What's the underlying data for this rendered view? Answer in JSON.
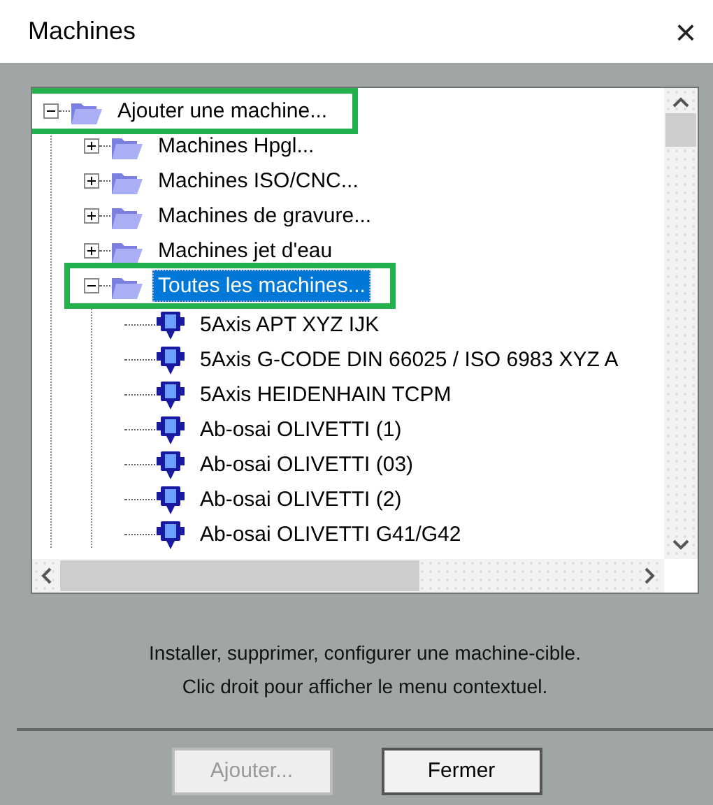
{
  "window": {
    "title": "Machines",
    "close": "×"
  },
  "tree": [
    {
      "label": "Ajouter une machine...",
      "kind": "folder",
      "expanded": true,
      "selected": false,
      "highlighted": true,
      "children": [
        {
          "label": "Machines Hpgl...",
          "kind": "folder",
          "expanded": false,
          "selected": false,
          "highlighted": false
        },
        {
          "label": "Machines ISO/CNC...",
          "kind": "folder",
          "expanded": false,
          "selected": false,
          "highlighted": false
        },
        {
          "label": "Machines de gravure...",
          "kind": "folder",
          "expanded": false,
          "selected": false,
          "highlighted": false
        },
        {
          "label": "Machines jet d'eau",
          "kind": "folder",
          "expanded": false,
          "selected": false,
          "highlighted": false
        },
        {
          "label": "Toutes les machines...",
          "kind": "folder",
          "expanded": true,
          "selected": true,
          "highlighted": true,
          "children": [
            {
              "label": "5Axis APT XYZ IJK",
              "kind": "machine",
              "selected": false,
              "highlighted": false
            },
            {
              "label": "5Axis G-CODE DIN 66025 / ISO 6983 XYZ A",
              "kind": "machine",
              "selected": false,
              "highlighted": false
            },
            {
              "label": "5Axis HEIDENHAIN TCPM",
              "kind": "machine",
              "selected": false,
              "highlighted": false
            },
            {
              "label": "Ab-osai  OLIVETTI (1)",
              "kind": "machine",
              "selected": false,
              "highlighted": false
            },
            {
              "label": "Ab-osai OLIVETTI (03)",
              "kind": "machine",
              "selected": false,
              "highlighted": false
            },
            {
              "label": "Ab-osai OLIVETTI (2)",
              "kind": "machine",
              "selected": false,
              "highlighted": false
            },
            {
              "label": "Ab-osai OLIVETTI G41/G42",
              "kind": "machine",
              "selected": false,
              "highlighted": false
            }
          ]
        }
      ]
    }
  ],
  "message": [
    "Installer, supprimer, configurer une machine-cible.",
    "Clic droit pour afficher le menu contextuel."
  ],
  "buttons": [
    {
      "label": "Ajouter...",
      "disabled": true
    },
    {
      "label": "Fermer",
      "disabled": false
    }
  ]
}
